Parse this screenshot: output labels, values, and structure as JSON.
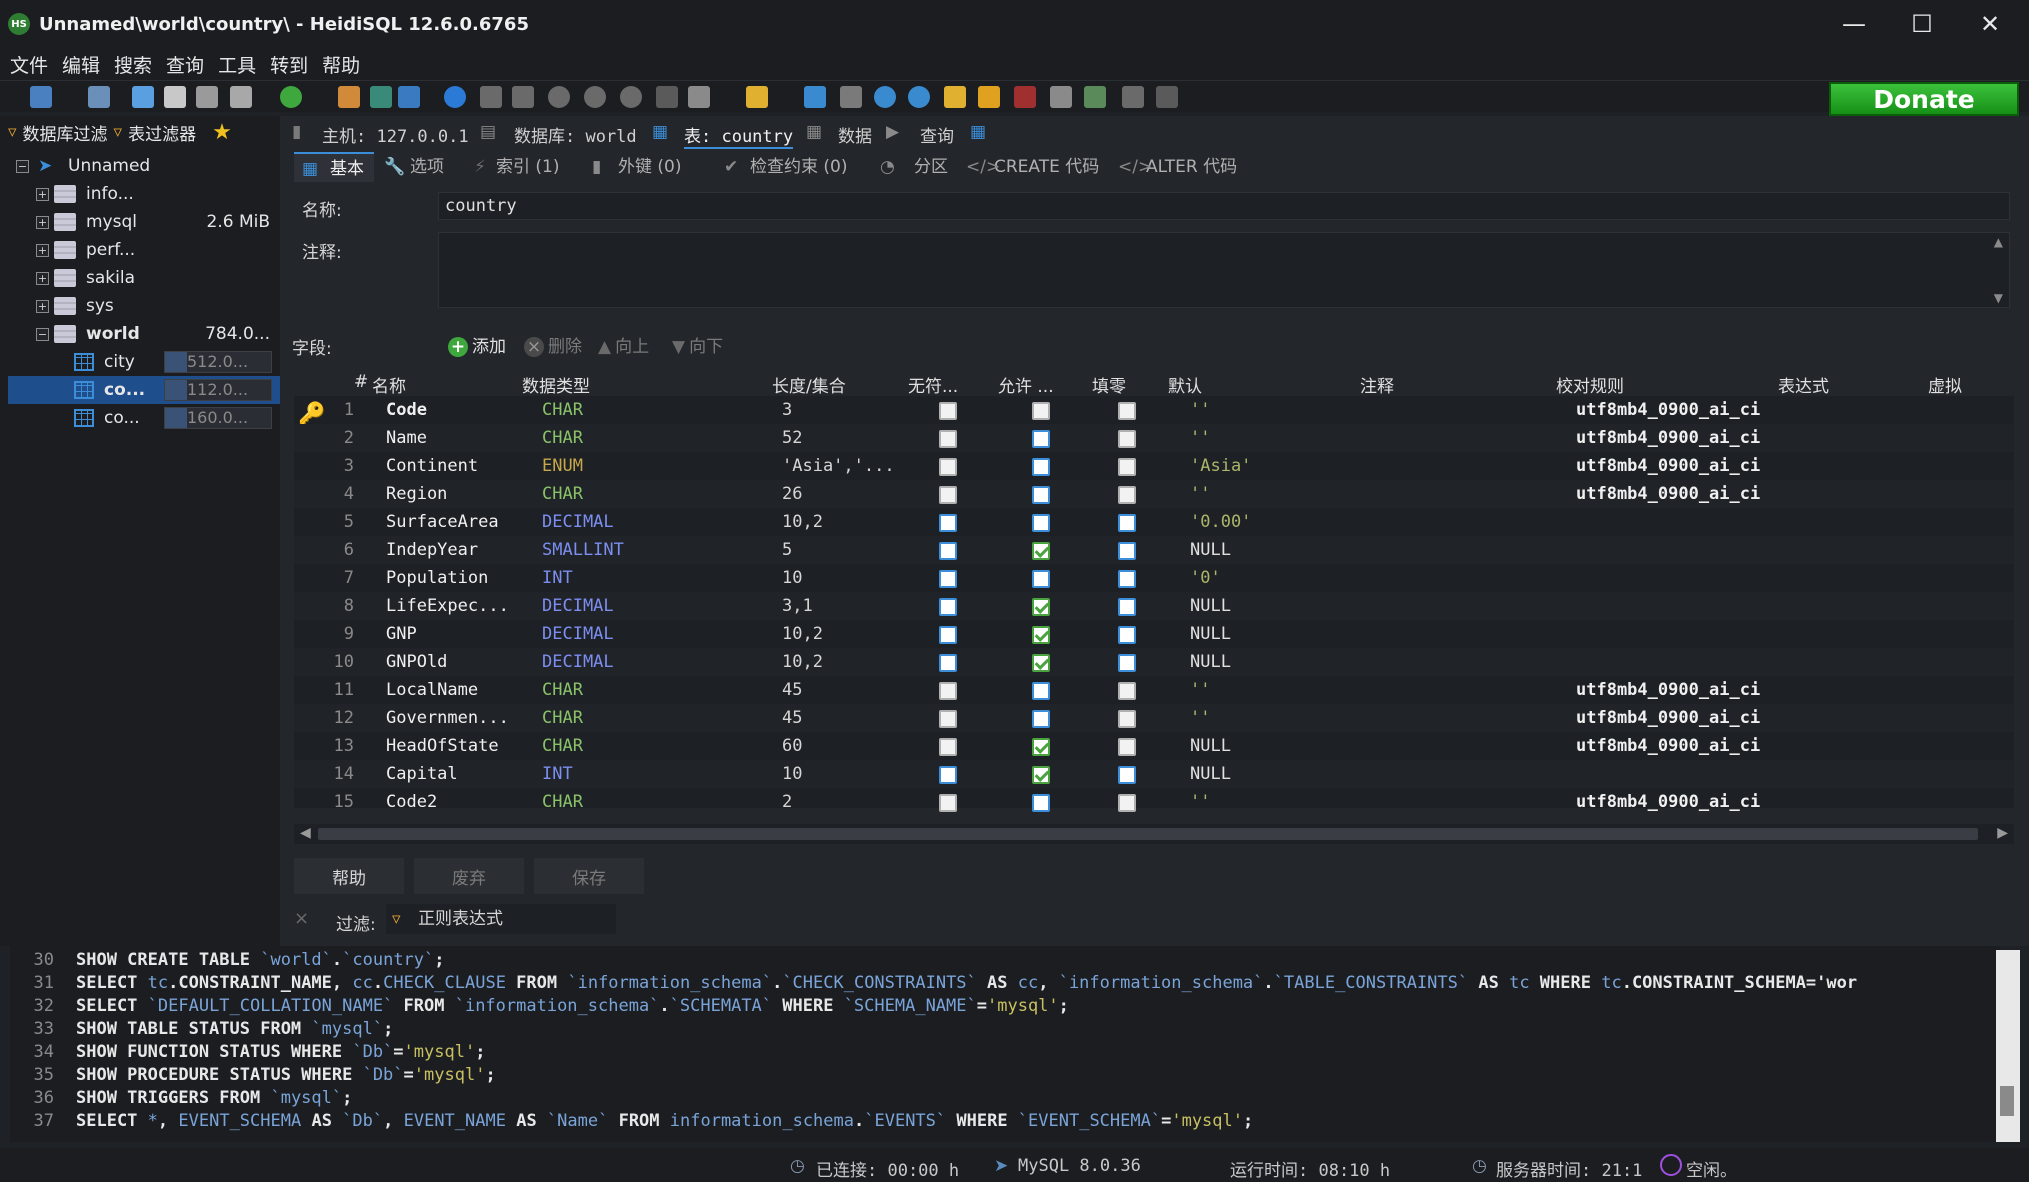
{
  "window": {
    "title": "Unnamed\\world\\country\\ - HeidiSQL 12.6.0.6765",
    "icon_text": "HS"
  },
  "menu": [
    "文件",
    "编辑",
    "搜索",
    "查询",
    "工具",
    "转到",
    "帮助"
  ],
  "donate_label": "Donate",
  "sidebar": {
    "filter_db_label": "数据库过滤",
    "filter_table_label": "表过滤器",
    "root": "Unnamed",
    "items": [
      {
        "name": "info...",
        "size": ""
      },
      {
        "name": "mysql",
        "size": "2.6 MiB"
      },
      {
        "name": "perf...",
        "size": ""
      },
      {
        "name": "sakila",
        "size": ""
      },
      {
        "name": "sys",
        "size": ""
      },
      {
        "name": "world",
        "size": "784.0..."
      }
    ],
    "tables": [
      {
        "name": "city",
        "size": "512.0..."
      },
      {
        "name": "co...",
        "size": "112.0..."
      },
      {
        "name": "co...",
        "size": "160.0..."
      }
    ]
  },
  "breadcrumb": {
    "host": "主机: 127.0.0.1",
    "database": "数据库: world",
    "table": "表: country",
    "data": "数据",
    "query": "查询"
  },
  "tabs": [
    "基本",
    "选项",
    "索引 (1)",
    "外键 (0)",
    "检查约束 (0)",
    "分区",
    "CREATE 代码",
    "ALTER 代码"
  ],
  "form": {
    "name_label": "名称:",
    "name_value": "country",
    "comment_label": "注释:",
    "fields_label": "字段:"
  },
  "field_actions": [
    "添加",
    "删除",
    "向上",
    "向下"
  ],
  "columns": [
    "#",
    "名称",
    "数据类型",
    "长度/集合",
    "无符...",
    "允许 ...",
    "填零",
    "默认",
    "注释",
    "校对规则",
    "表达式",
    "虚拟"
  ],
  "fields": [
    {
      "n": "1",
      "name": "Code",
      "type": "CHAR",
      "len": "3",
      "unsigned": "none",
      "null": "none",
      "zero": "none",
      "def": "''",
      "coll": "utf8mb4_0900_ai_ci"
    },
    {
      "n": "2",
      "name": "Name",
      "type": "CHAR",
      "len": "52",
      "unsigned": "none",
      "null": "blue",
      "zero": "none",
      "def": "''",
      "coll": "utf8mb4_0900_ai_ci"
    },
    {
      "n": "3",
      "name": "Continent",
      "type": "ENUM",
      "len": "'Asia','...",
      "unsigned": "none",
      "null": "blue",
      "zero": "none",
      "def": "'Asia'",
      "coll": "utf8mb4_0900_ai_ci"
    },
    {
      "n": "4",
      "name": "Region",
      "type": "CHAR",
      "len": "26",
      "unsigned": "none",
      "null": "blue",
      "zero": "none",
      "def": "''",
      "coll": "utf8mb4_0900_ai_ci"
    },
    {
      "n": "5",
      "name": "SurfaceArea",
      "type": "DECIMAL",
      "len": "10,2",
      "unsigned": "blue",
      "null": "blue",
      "zero": "blue",
      "def": "'0.00'",
      "coll": ""
    },
    {
      "n": "6",
      "name": "IndepYear",
      "type": "SMALLINT",
      "len": "5",
      "unsigned": "blue",
      "null": "checked",
      "zero": "blue",
      "def": "NULL",
      "coll": ""
    },
    {
      "n": "7",
      "name": "Population",
      "type": "INT",
      "len": "10",
      "unsigned": "blue",
      "null": "blue",
      "zero": "blue",
      "def": "'0'",
      "coll": ""
    },
    {
      "n": "8",
      "name": "LifeExpec...",
      "type": "DECIMAL",
      "len": "3,1",
      "unsigned": "blue",
      "null": "checked",
      "zero": "blue",
      "def": "NULL",
      "coll": ""
    },
    {
      "n": "9",
      "name": "GNP",
      "type": "DECIMAL",
      "len": "10,2",
      "unsigned": "blue",
      "null": "checked",
      "zero": "blue",
      "def": "NULL",
      "coll": ""
    },
    {
      "n": "10",
      "name": "GNPOld",
      "type": "DECIMAL",
      "len": "10,2",
      "unsigned": "blue",
      "null": "checked",
      "zero": "blue",
      "def": "NULL",
      "coll": ""
    },
    {
      "n": "11",
      "name": "LocalName",
      "type": "CHAR",
      "len": "45",
      "unsigned": "none",
      "null": "blue",
      "zero": "none",
      "def": "''",
      "coll": "utf8mb4_0900_ai_ci"
    },
    {
      "n": "12",
      "name": "Governmen...",
      "type": "CHAR",
      "len": "45",
      "unsigned": "none",
      "null": "blue",
      "zero": "none",
      "def": "''",
      "coll": "utf8mb4_0900_ai_ci"
    },
    {
      "n": "13",
      "name": "HeadOfState",
      "type": "CHAR",
      "len": "60",
      "unsigned": "none",
      "null": "checked",
      "zero": "none",
      "def": "NULL",
      "coll": "utf8mb4_0900_ai_ci"
    },
    {
      "n": "14",
      "name": "Capital",
      "type": "INT",
      "len": "10",
      "unsigned": "blue",
      "null": "checked",
      "zero": "blue",
      "def": "NULL",
      "coll": ""
    },
    {
      "n": "15",
      "name": "Code2",
      "type": "CHAR",
      "len": "2",
      "unsigned": "none",
      "null": "blue",
      "zero": "none",
      "def": "''",
      "coll": "utf8mb4_0900_ai_ci"
    }
  ],
  "buttons": {
    "help": "帮助",
    "discard": "废弃",
    "save": "保存"
  },
  "filter": {
    "label": "过滤:",
    "placeholder": "正则表达式"
  },
  "sql_log": [
    {
      "n": "30",
      "parts": [
        [
          "k",
          "SHOW CREATE TABLE "
        ],
        [
          "q",
          "`world`"
        ],
        [
          "k",
          "."
        ],
        [
          "q",
          "`country`"
        ],
        [
          "k",
          ";"
        ]
      ]
    },
    {
      "n": "31",
      "parts": [
        [
          "k",
          "SELECT "
        ],
        [
          "q",
          "tc"
        ],
        [
          "k",
          ".CONSTRAINT_NAME, "
        ],
        [
          "q",
          "cc"
        ],
        [
          "k",
          "."
        ],
        [
          "q",
          "CHECK_CLAUSE"
        ],
        [
          "k",
          " FROM "
        ],
        [
          "q",
          "`information_schema`"
        ],
        [
          "k",
          "."
        ],
        [
          "q",
          "`CHECK_CONSTRAINTS`"
        ],
        [
          "k",
          " AS "
        ],
        [
          "q",
          "cc"
        ],
        [
          "k",
          ", "
        ],
        [
          "q",
          "`information_schema`"
        ],
        [
          "k",
          "."
        ],
        [
          "q",
          "`TABLE_CONSTRAINTS`"
        ],
        [
          "k",
          " AS "
        ],
        [
          "q",
          "tc"
        ],
        [
          "k",
          " WHERE "
        ],
        [
          "q",
          "tc"
        ],
        [
          "k",
          ".CONSTRAINT_SCHEMA='wor"
        ]
      ]
    },
    {
      "n": "32",
      "parts": [
        [
          "k",
          "SELECT "
        ],
        [
          "q",
          "`DEFAULT_COLLATION_NAME`"
        ],
        [
          "k",
          " FROM "
        ],
        [
          "q",
          "`information_schema`"
        ],
        [
          "k",
          "."
        ],
        [
          "q",
          "`SCHEMATA`"
        ],
        [
          "k",
          " WHERE "
        ],
        [
          "q",
          "`SCHEMA_NAME`"
        ],
        [
          "k",
          "="
        ],
        [
          "s",
          "'mysql'"
        ],
        [
          "k",
          ";"
        ]
      ]
    },
    {
      "n": "33",
      "parts": [
        [
          "k",
          "SHOW TABLE STATUS FROM "
        ],
        [
          "q",
          "`mysql`"
        ],
        [
          "k",
          ";"
        ]
      ]
    },
    {
      "n": "34",
      "parts": [
        [
          "k",
          "SHOW FUNCTION STATUS WHERE "
        ],
        [
          "q",
          "`Db`"
        ],
        [
          "k",
          "="
        ],
        [
          "s",
          "'mysql'"
        ],
        [
          "k",
          ";"
        ]
      ]
    },
    {
      "n": "35",
      "parts": [
        [
          "k",
          "SHOW PROCEDURE STATUS WHERE "
        ],
        [
          "q",
          "`Db`"
        ],
        [
          "k",
          "="
        ],
        [
          "s",
          "'mysql'"
        ],
        [
          "k",
          ";"
        ]
      ]
    },
    {
      "n": "36",
      "parts": [
        [
          "k",
          "SHOW TRIGGERS FROM "
        ],
        [
          "q",
          "`mysql`"
        ],
        [
          "k",
          ";"
        ]
      ]
    },
    {
      "n": "37",
      "parts": [
        [
          "k",
          "SELECT "
        ],
        [
          "q",
          "*"
        ],
        [
          "k",
          ", "
        ],
        [
          "q",
          "EVENT_SCHEMA"
        ],
        [
          "k",
          " AS "
        ],
        [
          "q",
          "`Db`"
        ],
        [
          "k",
          ", "
        ],
        [
          "q",
          "EVENT_NAME"
        ],
        [
          "k",
          " AS "
        ],
        [
          "q",
          "`Name`"
        ],
        [
          "k",
          " FROM "
        ],
        [
          "q",
          "information_schema"
        ],
        [
          "k",
          "."
        ],
        [
          "q",
          "`EVENTS`"
        ],
        [
          "k",
          " WHERE "
        ],
        [
          "q",
          "`EVENT_SCHEMA`"
        ],
        [
          "k",
          "="
        ],
        [
          "s",
          "'mysql'"
        ],
        [
          "k",
          ";"
        ]
      ]
    }
  ],
  "status": {
    "connected": "已连接: 00:00 h",
    "server": "MySQL 8.0.36",
    "uptime": "运行时间: 08:10 h",
    "server_time": "服务器时间: 21:1",
    "idle": "空闲。"
  }
}
